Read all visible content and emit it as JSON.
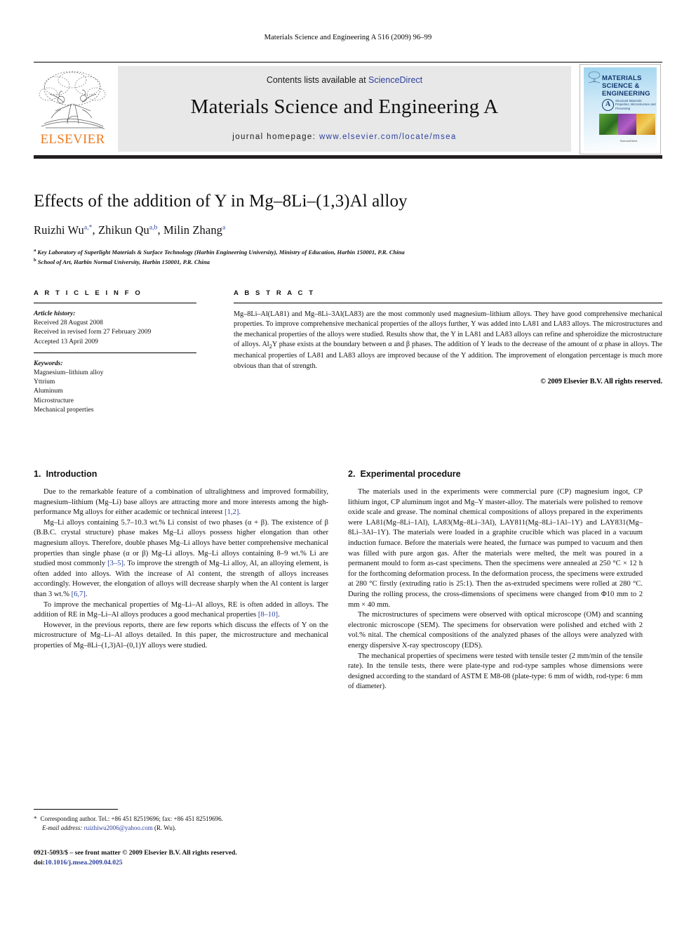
{
  "running_head": "Materials Science and Engineering A 516 (2009) 96–99",
  "masthead": {
    "contents_prefix": "Contents lists available at ",
    "sciencedirect": "ScienceDirect",
    "journal_title": "Materials Science and Engineering A",
    "homepage_prefix": "journal homepage: ",
    "homepage_url": "www.elsevier.com/locate/msea",
    "publisher_name": "ELSEVIER",
    "cover": {
      "title_line1": "MATERIALS",
      "title_line2": "SCIENCE &",
      "title_line3": "ENGINEERING",
      "badge": "A",
      "subtitle": "Structural Materials: Properties, Microstructure and Processing",
      "footer": "ScienceDirect"
    }
  },
  "article": {
    "title": "Effects of the addition of Y in Mg–8Li–(1,3)Al alloy",
    "authors": [
      {
        "name": "Ruizhi Wu",
        "marks": "a,*"
      },
      {
        "name": "Zhikun Qu",
        "marks": "a,b"
      },
      {
        "name": "Milin Zhang",
        "marks": "a"
      }
    ],
    "affiliations": [
      {
        "mark": "a",
        "text": "Key Laboratory of Superlight Materials & Surface Technology (Harbin Engineering University), Ministry of Education, Harbin 150001, P.R. China"
      },
      {
        "mark": "b",
        "text": "School of Art, Harbin Normal University, Harbin 150001, P.R. China"
      }
    ]
  },
  "article_info": {
    "heading": "A R T I C L E  I N F O",
    "history_label": "Article history:",
    "history": [
      "Received 28 August 2008",
      "Received in revised form 27 February 2009",
      "Accepted 13 April 2009"
    ],
    "keywords_label": "Keywords:",
    "keywords": [
      "Magnesium–lithium alloy",
      "Yttrium",
      "Aluminum",
      "Microstructure",
      "Mechanical properties"
    ]
  },
  "abstract": {
    "heading": "A B S T R A C T",
    "text": "Mg–8Li–Al(LA81) and Mg–8Li–3Al(LA83) are the most commonly used magnesium–lithium alloys. They have good comprehensive mechanical properties. To improve comprehensive mechanical properties of the alloys further, Y was added into LA81 and LA83 alloys. The microstructures and the mechanical properties of the alloys were studied. Results show that, the Y in LA81 and LA83 alloys can refine and spheroidize the microstructure of alloys. Al2Y phase exists at the boundary between α and β phases. The addition of Y leads to the decrease of the amount of α phase in alloys. The mechanical properties of LA81 and LA83 alloys are improved because of the Y addition. The improvement of elongation percentage is much more obvious than that of strength.",
    "copyright": "© 2009 Elsevier B.V. All rights reserved."
  },
  "sections": {
    "introduction": {
      "number": "1.",
      "title": "Introduction",
      "paragraphs": [
        "Due to the remarkable feature of a combination of ultralightness and improved formability, magnesium–lithium (Mg–Li) base alloys are attracting more and more interests among the high-performance Mg alloys for either academic or technical interest [1,2].",
        "Mg–Li alloys containing 5.7–10.3 wt.% Li consist of two phases (α + β). The existence of β (B.B.C. crystal structure) phase makes Mg–Li alloys possess higher elongation than other magnesium alloys. Therefore, double phases Mg–Li alloys have better comprehensive mechanical properties than single phase (α or β) Mg–Li alloys. Mg–Li alloys containing 8–9 wt.% Li are studied most commonly [3–5]. To improve the strength of Mg–Li alloy, Al, an alloying element, is often added into alloys. With the increase of Al content, the strength of alloys increases accordingly. However, the elongation of alloys will decrease sharply when the Al content is larger than 3 wt.% [6,7].",
        "To improve the mechanical properties of Mg–Li–Al alloys, RE is often added in alloys. The addition of RE in Mg–Li–Al alloys produces a good mechanical properties [8–10].",
        "However, in the previous reports, there are few reports which discuss the effects of Y on the microstructure of Mg–Li–Al alloys detailed. In this paper, the microstructure and mechanical properties of Mg–8Li–(1,3)Al–(0,1)Y alloys were studied."
      ]
    },
    "experimental": {
      "number": "2.",
      "title": "Experimental procedure",
      "paragraphs": [
        "The materials used in the experiments were commercial pure (CP) magnesium ingot, CP lithium ingot, CP aluminum ingot and Mg–Y master-alloy. The materials were polished to remove oxide scale and grease. The nominal chemical compositions of alloys prepared in the experiments were LA81(Mg–8Li–1Al), LA83(Mg–8Li–3Al), LAY811(Mg–8Li–1Al–1Y) and LAY831(Mg–8Li–3Al–1Y). The materials were loaded in a graphite crucible which was placed in a vacuum induction furnace. Before the materials were heated, the furnace was pumped to vacuum and then was filled with pure argon gas. After the materials were melted, the melt was poured in a permanent mould to form as-cast specimens. Then the specimens were annealed at 250 °C × 12 h for the forthcoming deformation process. In the deformation process, the specimens were extruded at 280 °C firstly (extruding ratio is 25:1). Then the as-extruded specimens were rolled at 280 °C. During the rolling process, the cross-dimensions of specimens were changed from Φ10 mm to 2 mm × 40 mm.",
        "The microstructures of specimens were observed with optical microscope (OM) and scanning electronic microscope (SEM). The specimens for observation were polished and etched with 2 vol.% nital. The chemical compositions of the analyzed phases of the alloys were analyzed with energy dispersive X-ray spectroscopy (EDS).",
        "The mechanical properties of specimens were tested with tensile tester (2 mm/min of the tensile rate). In the tensile tests, there were plate-type and rod-type samples whose dimensions were designed according to the standard of ASTM E M8-08 (plate-type: 6 mm of width, rod-type: 6 mm of diameter)."
      ]
    }
  },
  "footnote": {
    "star": "*",
    "corresponding": "Corresponding author. Tel.: +86 451 82519696; fax: +86 451 82519696.",
    "email_label": "E-mail address:",
    "email": "ruizhiwu2006@yahoo.com",
    "email_suffix": "(R. Wu)."
  },
  "page_footer": {
    "front_matter": "0921-5093/$ – see front matter © 2009 Elsevier B.V. All rights reserved.",
    "doi_label": "doi:",
    "doi": "10.1016/j.msea.2009.04.025"
  },
  "colors": {
    "link_blue": "#2b3f9e",
    "elsevier_orange": "#f07c21",
    "band_grey": "#e8e8e8"
  }
}
